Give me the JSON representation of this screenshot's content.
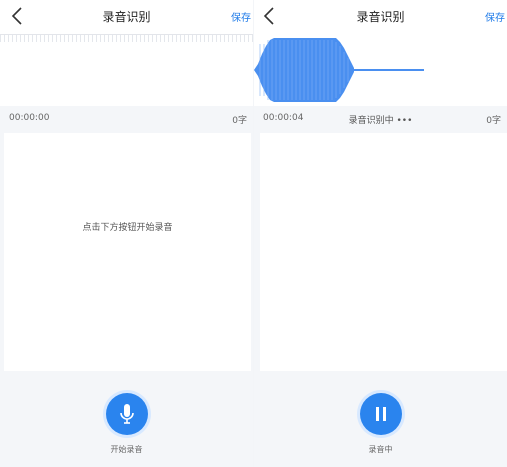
{
  "left_screen": {
    "nav": {
      "title": "录音识别",
      "save_label": "保存",
      "back_icon": "chevron-left-icon"
    },
    "timer": "00:00:00",
    "char_count": "0字",
    "placeholder": "点击下方按钮开始录音",
    "button_label": "开始录音",
    "button_icon": "microphone-icon"
  },
  "right_screen": {
    "nav": {
      "title": "录音识别",
      "save_label": "保存",
      "back_icon": "chevron-left-icon"
    },
    "timer": "00:00:04",
    "status": "录音识别中 •••",
    "char_count": "0字",
    "button_label": "录音中",
    "button_icon": "pause-icon"
  },
  "colors": {
    "accent": "#2a84ee",
    "waveform": "#4a8ff0",
    "background": "#f4f6f9"
  }
}
